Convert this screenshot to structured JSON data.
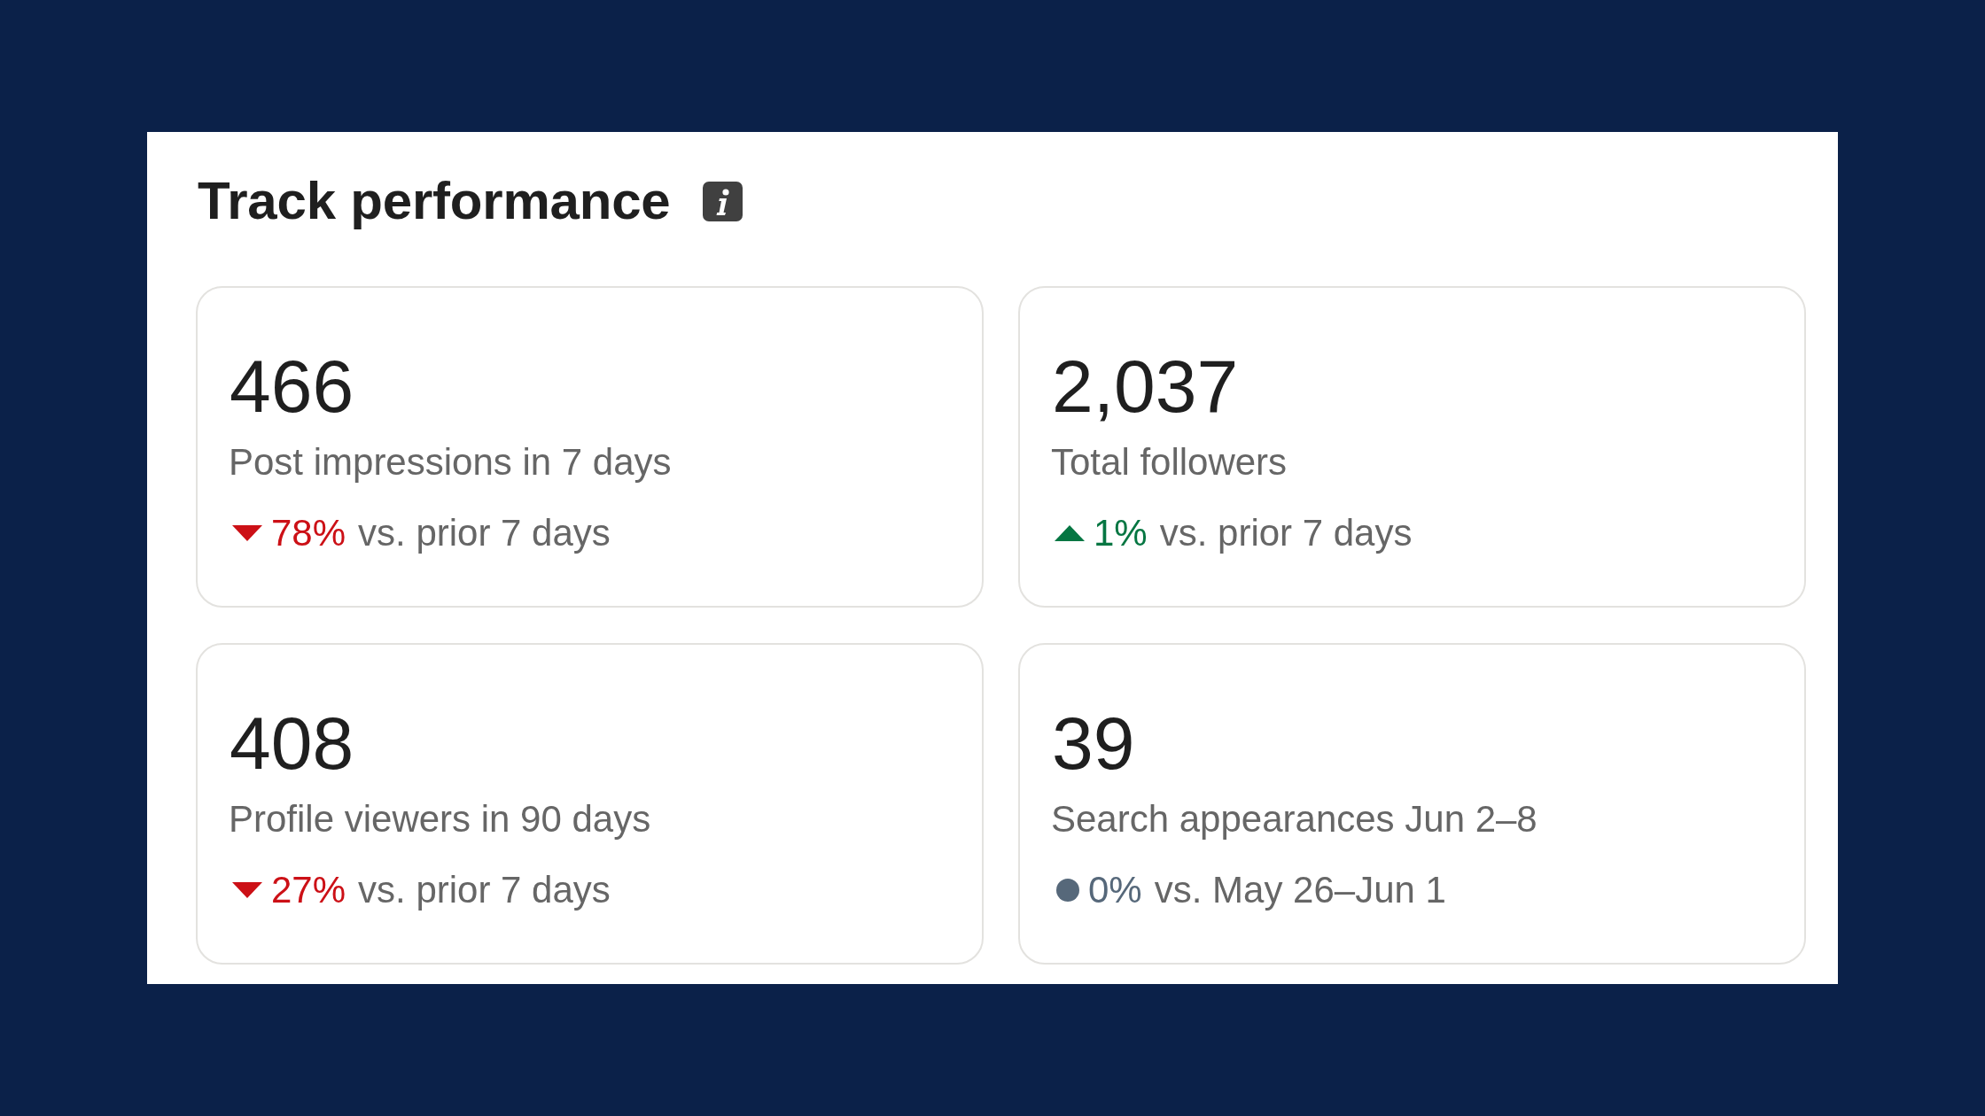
{
  "panel": {
    "title": "Track performance"
  },
  "metrics": [
    {
      "value": "466",
      "label": "Post impressions in 7 days",
      "kind": "down",
      "change": "78%",
      "comparison": "vs. prior 7 days"
    },
    {
      "value": "2,037",
      "label": "Total followers",
      "kind": "up",
      "change": "1%",
      "comparison": "vs. prior 7 days"
    },
    {
      "value": "408",
      "label": "Profile viewers in 90 days",
      "kind": "down",
      "change": "27%",
      "comparison": "vs. prior 7 days"
    },
    {
      "value": "39",
      "label": "Search appearances Jun 2–8",
      "kind": "neutral",
      "change": "0%",
      "comparison": "vs. May 26–Jun 1"
    }
  ]
}
